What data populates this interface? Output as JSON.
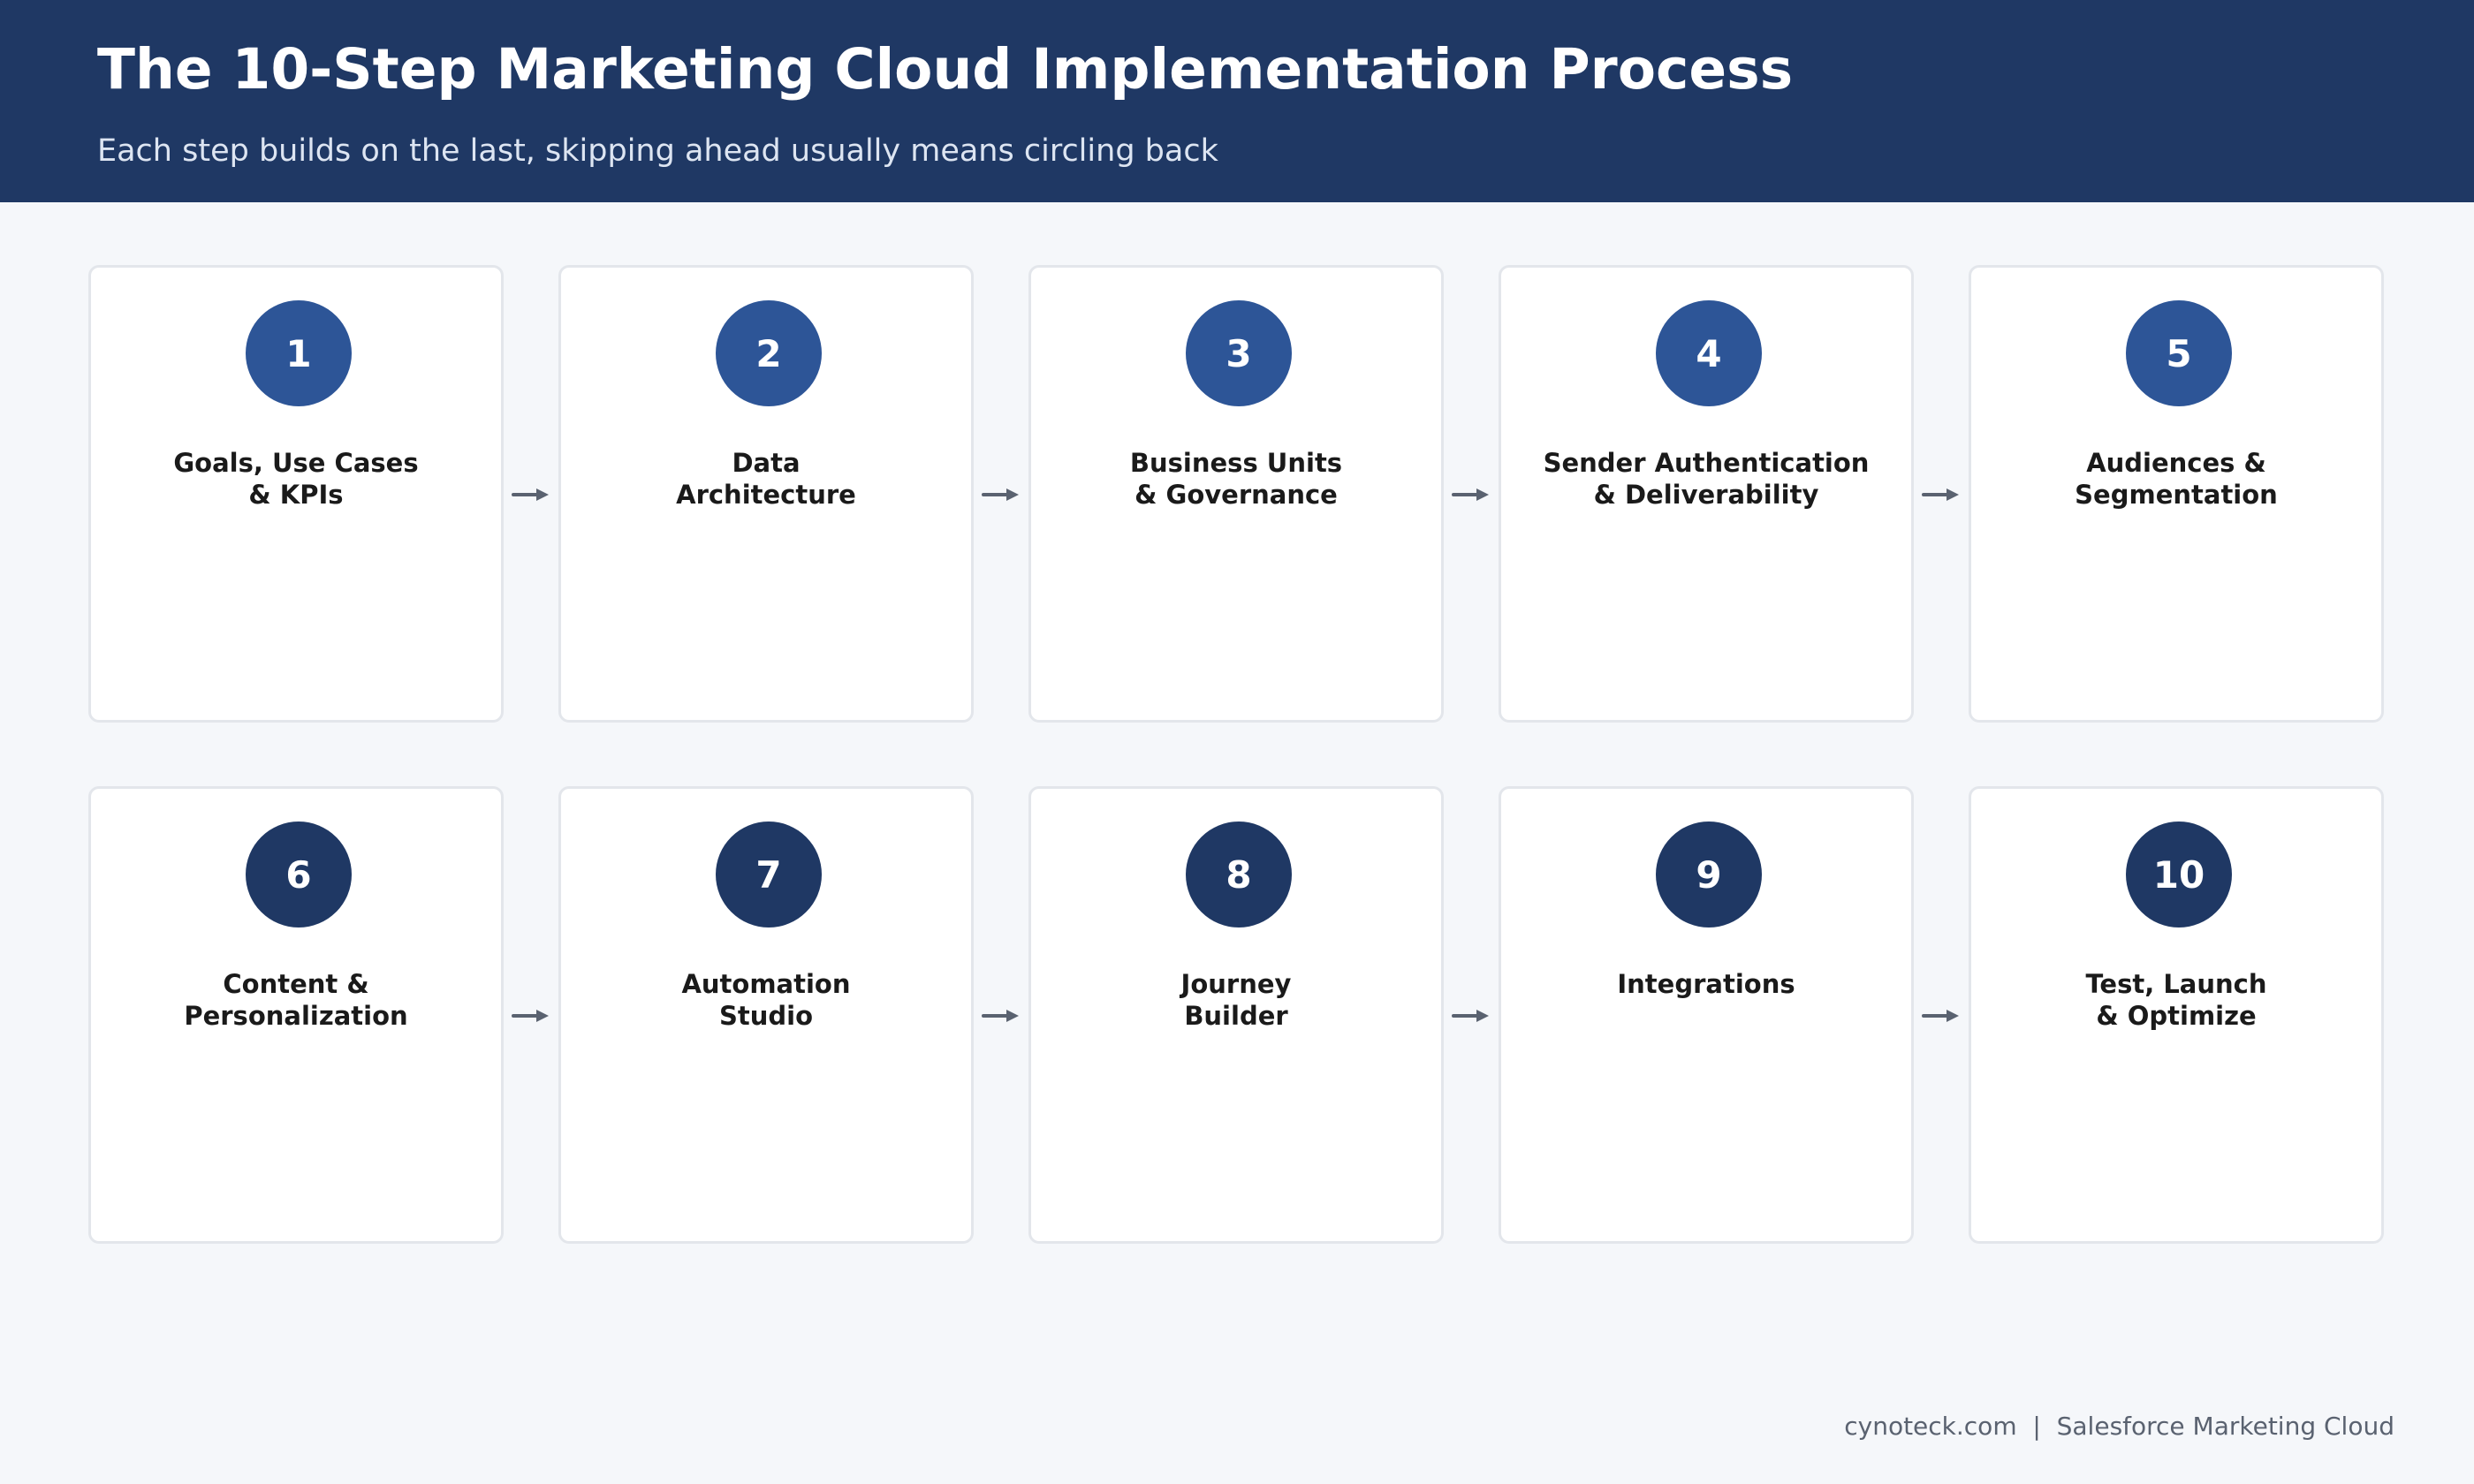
{
  "header": {
    "title": "The 10-Step Marketing Cloud Implementation Process",
    "subtitle": "Each step builds on the last, skipping ahead usually means circling back"
  },
  "steps": [
    {
      "number": "1",
      "title": "Goals, Use Cases\n& KPIs"
    },
    {
      "number": "2",
      "title": "Data\nArchitecture"
    },
    {
      "number": "3",
      "title": "Business Units\n& Governance"
    },
    {
      "number": "4",
      "title": "Sender Authentication\n& Deliverability"
    },
    {
      "number": "5",
      "title": "Audiences &\nSegmentation"
    },
    {
      "number": "6",
      "title": "Content &\nPersonalization"
    },
    {
      "number": "7",
      "title": "Automation\nStudio"
    },
    {
      "number": "8",
      "title": "Journey\nBuilder"
    },
    {
      "number": "9",
      "title": "Integrations"
    },
    {
      "number": "10",
      "title": "Test, Launch\n& Optimize"
    }
  ],
  "footer": {
    "text": "cynoteck.com  |  Salesforce Marketing Cloud"
  },
  "colors": {
    "header_bg": "#1f3864",
    "row1_circle": "#2d5597",
    "row2_circle": "#1f3864",
    "arrow": "#5a6270"
  }
}
